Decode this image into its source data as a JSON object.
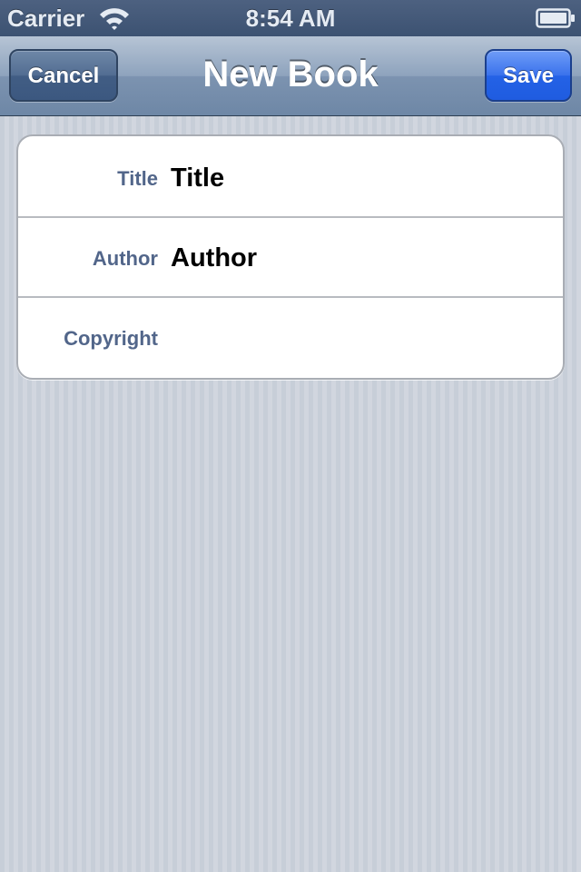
{
  "status_bar": {
    "carrier": "Carrier",
    "time": "8:54 AM",
    "wifi_icon": "wifi-icon",
    "battery_icon": "battery-icon"
  },
  "nav_bar": {
    "title": "New Book",
    "cancel_label": "Cancel",
    "save_label": "Save"
  },
  "form": {
    "fields": [
      {
        "label": "Title",
        "value": "Title"
      },
      {
        "label": "Author",
        "value": "Author"
      },
      {
        "label": "Copyright",
        "value": ""
      }
    ]
  },
  "colors": {
    "status_bar_bg": "#445a7a",
    "nav_bar_bg": "#8ea3bd",
    "save_button": "#2462e6",
    "cancel_button": "#415d84",
    "field_label": "#52668a",
    "background": "#cbd1da"
  }
}
